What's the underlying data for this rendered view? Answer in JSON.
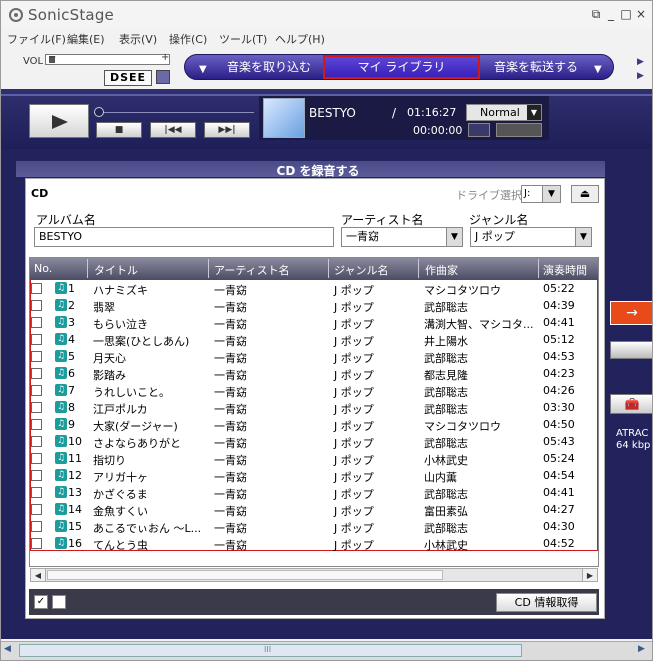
{
  "app": {
    "title": "SonicStage",
    "window_controls": {
      "restore": "⧉",
      "minimize": "_",
      "maximize": "□",
      "close": "×"
    }
  },
  "menu": [
    "ファイル(F)",
    "編集(E)",
    "表示(V)",
    "操作(C)",
    "ツール(T)",
    "ヘルプ(H)"
  ],
  "toolbar": {
    "vol_label": "VOL",
    "vol_minus": "−",
    "vol_plus": "+",
    "vol_level": 0.02,
    "dsee_label": "DSEE"
  },
  "modes": {
    "import_label": "音楽を取り込む",
    "library_label": "マイ ライブラリ",
    "transfer_label": "音楽を転送する",
    "arrow_glyph": "▼"
  },
  "player": {
    "track_name": "BESTYO",
    "slash": "/",
    "total_time": "01:16:27",
    "elapsed_time": "00:00:00",
    "play_mode": "Normal",
    "stop_glyph": "■",
    "prev_glyph": "|◀◀",
    "next_glyph": "▶▶|"
  },
  "record": {
    "title": "CD を録音する",
    "cd_label": "CD",
    "drive_label": "ドライブ選択:",
    "drive_value": "J:",
    "eject_glyph": "⏏",
    "album_label": "アルバム名",
    "album_value": "BESTYO",
    "artist_label": "アーティスト名",
    "artist_value": "一青窈",
    "genre_label": "ジャンル名",
    "genre_value": "J ポップ",
    "columns": [
      "No.",
      "タイトル",
      "アーティスト名",
      "ジャンル名",
      "作曲家",
      "演奏時間"
    ],
    "tracks": [
      {
        "no": "1",
        "title": "ハナミズキ",
        "artist": "一青窈",
        "genre": "J ポップ",
        "composer": "マシコタツロウ",
        "time": "05:22"
      },
      {
        "no": "2",
        "title": "翡翠",
        "artist": "一青窈",
        "genre": "J ポップ",
        "composer": "武部聡志",
        "time": "04:39"
      },
      {
        "no": "3",
        "title": "もらい泣き",
        "artist": "一青窈",
        "genre": "J ポップ",
        "composer": "溝渕大智、マシコタ...",
        "time": "04:41"
      },
      {
        "no": "4",
        "title": "一思案(ひとしあん)",
        "artist": "一青窈",
        "genre": "J ポップ",
        "composer": "井上陽水",
        "time": "05:12"
      },
      {
        "no": "5",
        "title": "月天心",
        "artist": "一青窈",
        "genre": "J ポップ",
        "composer": "武部聡志",
        "time": "04:53"
      },
      {
        "no": "6",
        "title": "影踏み",
        "artist": "一青窈",
        "genre": "J ポップ",
        "composer": "都志見隆",
        "time": "04:23"
      },
      {
        "no": "7",
        "title": "うれしいこと。",
        "artist": "一青窈",
        "genre": "J ポップ",
        "composer": "武部聡志",
        "time": "04:26"
      },
      {
        "no": "8",
        "title": "江戸ポルカ",
        "artist": "一青窈",
        "genre": "J ポップ",
        "composer": "武部聡志",
        "time": "03:30"
      },
      {
        "no": "9",
        "title": "大家(ダージャー)",
        "artist": "一青窈",
        "genre": "J ポップ",
        "composer": "マシコタツロウ",
        "time": "04:50"
      },
      {
        "no": "10",
        "title": "さよならありがと",
        "artist": "一青窈",
        "genre": "J ポップ",
        "composer": "武部聡志",
        "time": "05:43"
      },
      {
        "no": "11",
        "title": "指切り",
        "artist": "一青窈",
        "genre": "J ポップ",
        "composer": "小林武史",
        "time": "05:24"
      },
      {
        "no": "12",
        "title": "アリガ十ヶ",
        "artist": "一青窈",
        "genre": "J ポップ",
        "composer": "山内薫",
        "time": "04:54"
      },
      {
        "no": "13",
        "title": "かざぐるま",
        "artist": "一青窈",
        "genre": "J ポップ",
        "composer": "武部聡志",
        "time": "04:41"
      },
      {
        "no": "14",
        "title": "金魚すくい",
        "artist": "一青窈",
        "genre": "J ポップ",
        "composer": "富田素弘",
        "time": "04:27"
      },
      {
        "no": "15",
        "title": "あこるでぃおん 〜L...",
        "artist": "一青窈",
        "genre": "J ポップ",
        "composer": "武部聡志",
        "time": "04:30"
      },
      {
        "no": "16",
        "title": "てんとう虫",
        "artist": "一青窈",
        "genre": "J ポップ",
        "composer": "小林武史",
        "time": "04:52"
      }
    ],
    "cd_info_button": "CD 情報取得"
  },
  "side": {
    "arrow_glyph": "→",
    "toolbox_glyph": "🧰",
    "format_line1": "ATRAC",
    "format_line2": "64 kbp"
  },
  "scroll": {
    "left": "◀",
    "right": "▶",
    "grip": "III"
  },
  "colors": {
    "accent": "#2a1f86",
    "highlight": "#d01a1a",
    "track_icon": "#1c9c9c",
    "transfer": "#e84a1a"
  }
}
